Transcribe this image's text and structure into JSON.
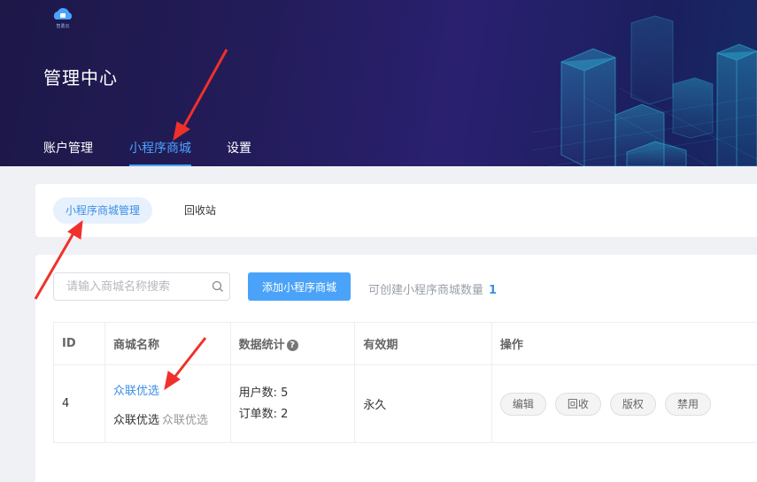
{
  "header": {
    "logo_text": "智勇云",
    "title": "管理中心",
    "nav": [
      {
        "label": "账户管理"
      },
      {
        "label": "小程序商城"
      },
      {
        "label": "设置"
      }
    ]
  },
  "tabs": [
    {
      "label": "小程序商城管理"
    },
    {
      "label": "回收站"
    }
  ],
  "toolbar": {
    "search_placeholder": "请输入商城名称搜索",
    "add_label": "添加小程序商城",
    "quota_label": "可创建小程序商城数量",
    "quota_value": "1"
  },
  "table": {
    "headers": [
      "ID",
      "商城名称",
      "数据统计",
      "有效期",
      "操作"
    ],
    "rows": [
      {
        "id": "4",
        "name_link": "众联优选",
        "name_main": "众联优选",
        "name_sub": "众联优选",
        "users": "用户数: 5",
        "orders": "订单数: 2",
        "validity": "永久",
        "actions": [
          "编辑",
          "回收",
          "版权",
          "禁用"
        ]
      }
    ]
  },
  "colors": {
    "accent": "#3c8ee6",
    "primary_button": "#4aa3f8",
    "header_bg": "#231c5a",
    "annotation_arrow": "#f0312b"
  }
}
